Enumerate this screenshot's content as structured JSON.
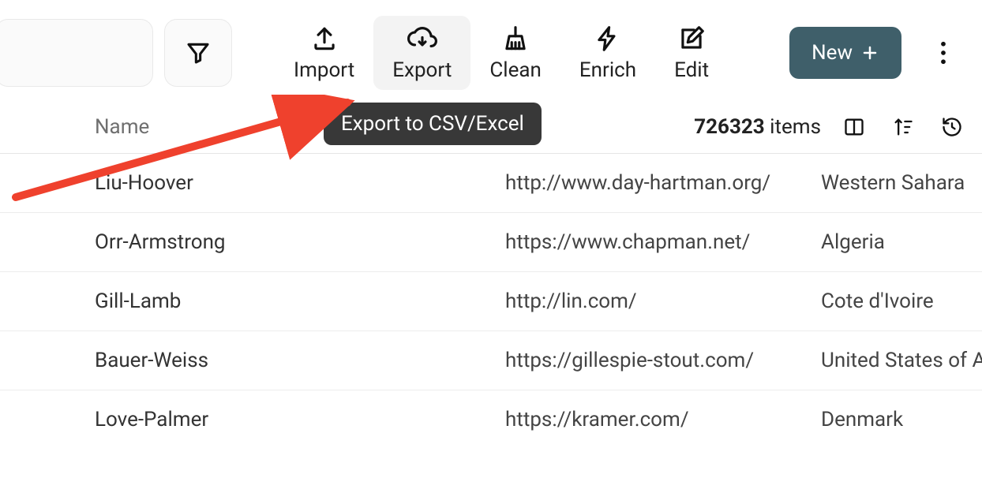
{
  "toolbar": {
    "import_label": "Import",
    "export_label": "Export",
    "clean_label": "Clean",
    "enrich_label": "Enrich",
    "edit_label": "Edit",
    "new_label": "New"
  },
  "tooltip": {
    "export_csv": "Export to CSV/Excel"
  },
  "subbar": {
    "name_header": "Name",
    "items_count": "726323",
    "items_label": " items"
  },
  "rows": [
    {
      "name": "Liu-Hoover",
      "url": "http://www.day-hartman.org/",
      "country": "Western Sahara"
    },
    {
      "name": "Orr-Armstrong",
      "url": "https://www.chapman.net/",
      "country": "Algeria"
    },
    {
      "name": "Gill-Lamb",
      "url": "http://lin.com/",
      "country": "Cote d'Ivoire"
    },
    {
      "name": "Bauer-Weiss",
      "url": "https://gillespie-stout.com/",
      "country": "United States of America"
    },
    {
      "name": "Love-Palmer",
      "url": "https://kramer.com/",
      "country": "Denmark"
    }
  ],
  "icons": {
    "filter": "filter-icon",
    "import": "upload-icon",
    "export": "cloud-download-icon",
    "clean": "broom-icon",
    "enrich": "bolt-icon",
    "edit": "pencil-square-icon",
    "new_plus": "plus-icon",
    "more": "dots-vertical-icon",
    "columns": "columns-icon",
    "sort": "sort-icon",
    "history": "history-icon"
  },
  "colors": {
    "new_button": "#3f5f6a",
    "tooltip_bg": "#383838",
    "arrow": "#ef412d"
  }
}
